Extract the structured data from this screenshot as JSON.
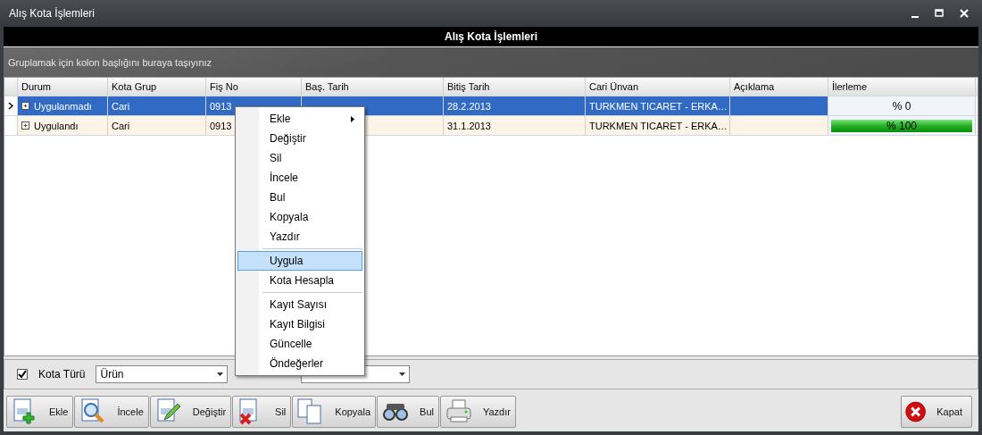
{
  "window": {
    "title": "Alış Kota İşlemleri"
  },
  "header": {
    "title": "Alış Kota İşlemleri"
  },
  "group_panel": {
    "hint": "Gruplamak için kolon başlığını buraya taşıyınız"
  },
  "table": {
    "columns": [
      "Durum",
      "Kota Grup",
      "Fiş No",
      "Baş. Tarih",
      "Bitiş Tarih",
      "Cari Ünvan",
      "Açıklama",
      "İlerleme"
    ],
    "rows": [
      {
        "selected": true,
        "cells": [
          "Uygulanmadı",
          "Cari",
          "0913",
          "",
          "28.2.2013",
          "TURKMEN TICARET - ERKA…",
          ""
        ],
        "progress": {
          "text": "% 0",
          "level": 0
        }
      },
      {
        "selected": false,
        "cells": [
          "Uygulandı",
          "Cari",
          "0913",
          "",
          "31.1.2013",
          "TURKMEN TICARET - ERKA…",
          ""
        ],
        "progress": {
          "text": "% 100",
          "level": 1
        }
      }
    ]
  },
  "context_menu": {
    "items": [
      {
        "label": "Ekle",
        "submenu": true,
        "selected": false
      },
      {
        "label": "Değiştir",
        "submenu": false,
        "selected": false
      },
      {
        "label": "Sil",
        "submenu": false,
        "selected": false
      },
      {
        "label": "İncele",
        "submenu": false,
        "selected": false
      },
      {
        "label": "Bul",
        "submenu": false,
        "selected": false
      },
      {
        "label": "Kopyala",
        "submenu": false,
        "selected": false
      },
      {
        "label": "Yazdır",
        "submenu": false,
        "selected": false,
        "separator_after": true
      },
      {
        "label": "Uygula",
        "submenu": false,
        "selected": true
      },
      {
        "label": "Kota Hesapla",
        "submenu": false,
        "selected": false,
        "separator_after": true
      },
      {
        "label": "Kayıt Sayısı",
        "submenu": false,
        "selected": false
      },
      {
        "label": "Kayıt Bilgisi",
        "submenu": false,
        "selected": false
      },
      {
        "label": "Güncelle",
        "submenu": false,
        "selected": false
      },
      {
        "label": "Öndeğerler",
        "submenu": false,
        "selected": false
      }
    ]
  },
  "filters": {
    "kota_turu": {
      "checked": true,
      "label": "Kota Türü",
      "value": "Ürün"
    }
  },
  "toolbar": [
    {
      "kind": "add",
      "label": "Ekle"
    },
    {
      "kind": "inspect",
      "label": "İncele"
    },
    {
      "kind": "edit",
      "label": "Değiştir"
    },
    {
      "kind": "delete",
      "label": "Sil"
    },
    {
      "kind": "copy",
      "label": "Kopyala"
    },
    {
      "kind": "find",
      "label": "Bul"
    },
    {
      "kind": "print",
      "label": "Yazdır"
    }
  ],
  "close_button": {
    "label": "Kapat"
  }
}
